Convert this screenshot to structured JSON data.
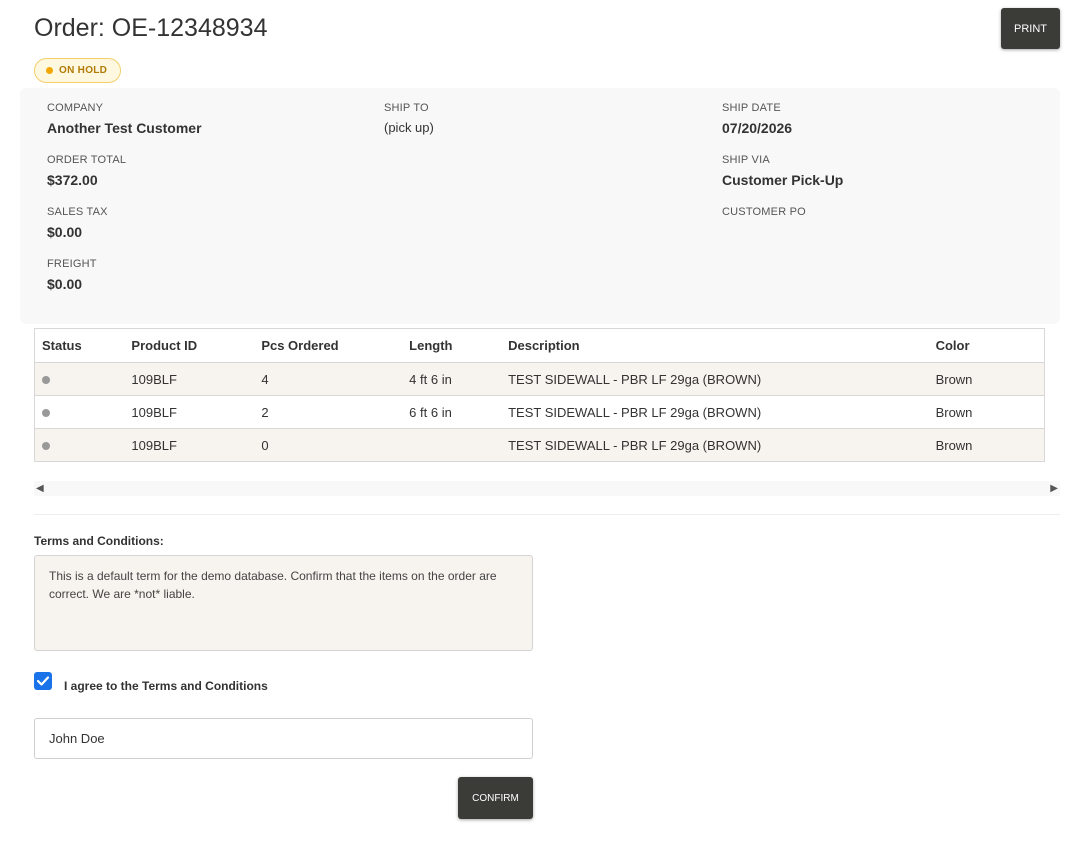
{
  "header": {
    "title": "Order: OE-12348934",
    "print_label": "PRINT",
    "status": "ON HOLD"
  },
  "info": {
    "company_label": "COMPANY",
    "company": "Another Test Customer",
    "ship_to_label": "SHIP TO",
    "ship_to": "(pick up)",
    "ship_date_label": "SHIP DATE",
    "ship_date": "07/20/2026",
    "order_total_label": "ORDER TOTAL",
    "order_total": "$372.00",
    "ship_via_label": "SHIP VIA",
    "ship_via": "Customer Pick-Up",
    "sales_tax_label": "SALES TAX",
    "sales_tax": "$0.00",
    "customer_po_label": "CUSTOMER PO",
    "customer_po": "",
    "freight_label": "FREIGHT",
    "freight": "$0.00"
  },
  "table": {
    "columns": [
      "Status",
      "Product ID",
      "Pcs Ordered",
      "Length",
      "Description",
      "Color"
    ],
    "rows": [
      {
        "product_id": "109BLF",
        "pcs": "4",
        "length": "4 ft 6 in",
        "description": "TEST SIDEWALL - PBR LF 29ga (BROWN)",
        "color": "Brown"
      },
      {
        "product_id": "109BLF",
        "pcs": "2",
        "length": "6 ft 6 in",
        "description": "TEST SIDEWALL - PBR LF 29ga (BROWN)",
        "color": "Brown"
      },
      {
        "product_id": "109BLF",
        "pcs": "0",
        "length": "",
        "description": "TEST SIDEWALL - PBR LF 29ga (BROWN)",
        "color": "Brown"
      }
    ]
  },
  "terms": {
    "heading": "Terms and Conditions:",
    "text": "This is a default term for the demo database. Confirm that the items on the order are correct. We are *not* liable.",
    "agree_label": "I agree to the Terms and Conditions",
    "agree_checked": true
  },
  "signature": {
    "value": "John Doe"
  },
  "actions": {
    "confirm_label": "CONFIRM"
  },
  "icons": {
    "scroll_left": "scroll-left-arrow-icon",
    "scroll_right": "scroll-right-arrow-icon",
    "checkmark": "checkmark-icon"
  },
  "colors": {
    "accent": "#1a73e8",
    "button_dark": "#3b3b37",
    "status_on_hold": "#f0a800",
    "row_stripe": "#f7f3ee"
  }
}
